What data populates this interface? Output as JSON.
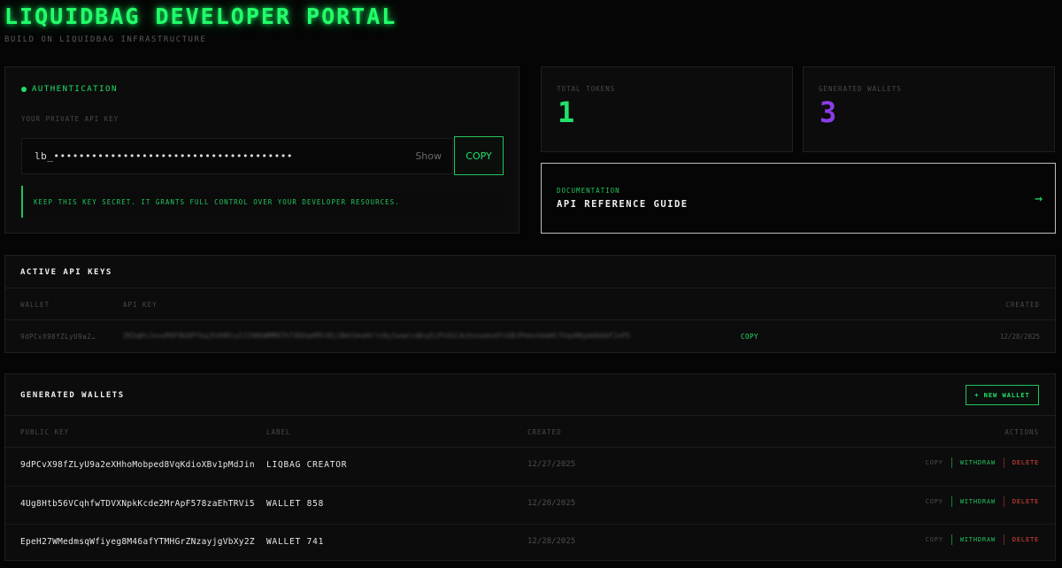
{
  "header": {
    "title": "LIQUIDBAG DEVELOPER PORTAL",
    "subtitle": "BUILD ON LIQUIDBAG INFRASTRUCTURE"
  },
  "auth": {
    "title": "AUTHENTICATION",
    "key_label": "YOUR PRIVATE API KEY",
    "key_value": "lb_••••••••••••••••••••••••••••••••••••••",
    "show_label": "Show",
    "copy_label": "COPY",
    "warning": "KEEP THIS KEY SECRET. IT GRANTS FULL CONTROL OVER YOUR DEVELOPER RESOURCES."
  },
  "stats": {
    "tokens_label": "TOTAL TOKENS",
    "tokens_value": "1",
    "wallets_label": "GENERATED WALLETS",
    "wallets_value": "3"
  },
  "docs": {
    "label": "DOCUMENTATION",
    "title": "API REFERENCE GUIDE",
    "arrow": "→"
  },
  "active_keys": {
    "title": "ACTIVE API KEYS",
    "columns": [
      "WALLET",
      "API KEY",
      "CREATED"
    ],
    "rows": [
      {
        "wallet": "9dPCvX98fZLyU9a2…",
        "api_key": "ZK5qHiJnxsM4F8G0PfkqJhXHRtyZJ298bNMM97hT4DUq4M5tKLCBmtbkeHrln9y1waelnBnyEzPnSGlAzhnsedvdfnSBJPkmshkmHCfVqoRKpmdbbbF2xPS",
        "copy_label": "COPY",
        "created": "12/28/2025"
      }
    ]
  },
  "wallets": {
    "title": "GENERATED WALLETS",
    "new_label": "+ NEW WALLET",
    "columns": [
      "PUBLIC KEY",
      "LABEL",
      "CREATED",
      "ACTIONS"
    ],
    "rows": [
      {
        "public_key": "9dPCvX98fZLyU9a2eXHhoMobped8VqKdioXBv1pMdJin",
        "label": "LIQBAG CREATOR",
        "created": "12/27/2025",
        "copy": "COPY",
        "withdraw": "WITHDRAW",
        "delete": "DELETE"
      },
      {
        "public_key": "4Ug8Htb56VCqhfwTDVXNpkKcde2MrApF578zaEhTRVi5",
        "label": "WALLET 858",
        "created": "12/28/2025",
        "copy": "COPY",
        "withdraw": "WITHDRAW",
        "delete": "DELETE"
      },
      {
        "public_key": "EpeH27WMedmsqWfiyeg8M46afYTMHGrZNzayjgVbXy2Z",
        "label": "WALLET 741",
        "created": "12/28/2025",
        "copy": "COPY",
        "withdraw": "WITHDRAW",
        "delete": "DELETE"
      }
    ]
  },
  "colors": {
    "accent_green": "#22e06a",
    "token_value": "#22e06a",
    "wallet_value": "#8a3ce6",
    "danger": "#e0463e",
    "separator_green": "#1f7a3c",
    "separator_red": "#7a2420"
  }
}
